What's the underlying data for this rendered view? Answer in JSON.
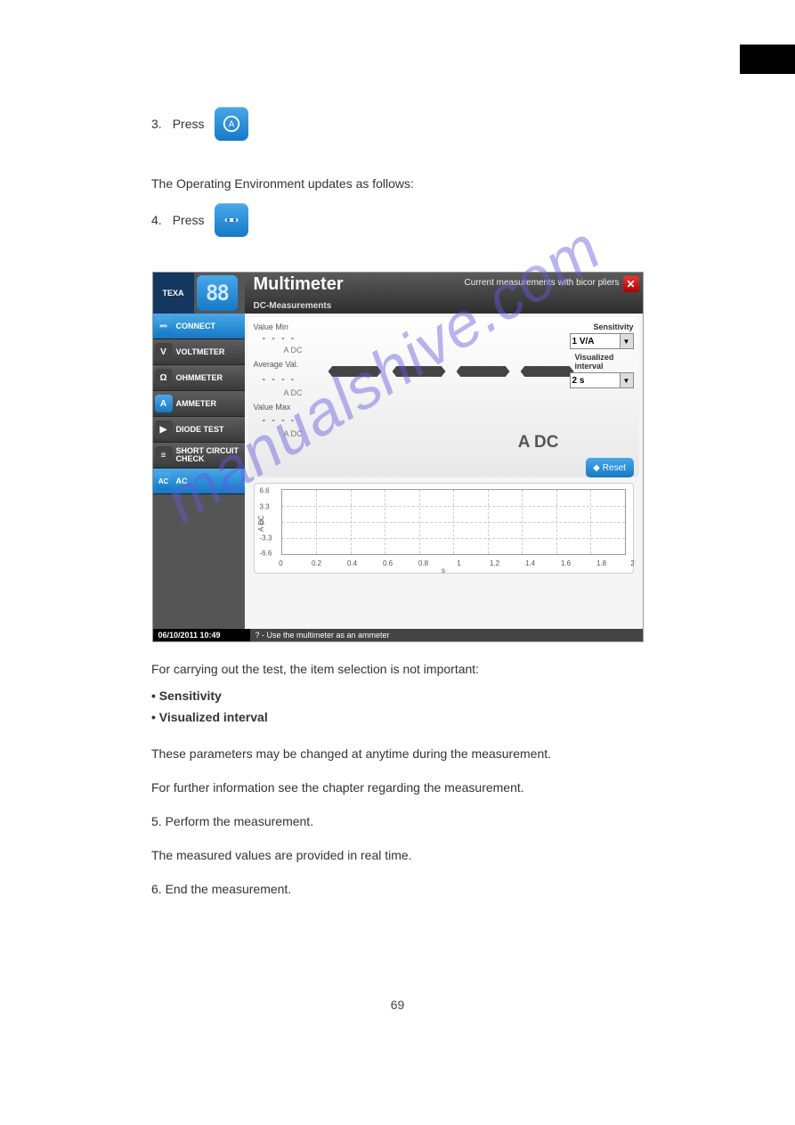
{
  "page": {
    "lang": "en",
    "number": "69",
    "watermark": "manualshive.com"
  },
  "instructions": {
    "step1_num": "3.",
    "step1_txt": "Press",
    "step1_after": "",
    "step2": "The Operating Environment updates as follows:",
    "step3_num": "4.",
    "step3_txt": "Press",
    "step3_after": ""
  },
  "app": {
    "logo": "TEXA",
    "display": "88",
    "title": "Multimeter",
    "subtitle": "DC-Measurements",
    "header_right": "Current measurements with bicor pliers",
    "sidebar": [
      {
        "label": "CONNECT",
        "sel": true,
        "ico": "⎓"
      },
      {
        "label": "VOLTMETER",
        "sel": false,
        "ico": "V"
      },
      {
        "label": "OHMMETER",
        "sel": false,
        "ico": "Ω"
      },
      {
        "label": "AMMETER",
        "sel": false,
        "ico": "A"
      },
      {
        "label": "DIODE TEST",
        "sel": false,
        "ico": "▶"
      },
      {
        "label": "SHORT CIRCUIT CHECK",
        "sel": false,
        "ico": "≡"
      },
      {
        "label": "AC",
        "sel": true,
        "ico": "AC"
      }
    ],
    "readings": {
      "min_lbl": "Value Min",
      "min_val": "- - - -",
      "min_unit": "A DC",
      "avg_lbl": "Average Val.",
      "avg_val": "- - - -",
      "avg_unit": "A DC",
      "max_lbl": "Value Max",
      "max_val": "- - - -",
      "max_unit": "A DC",
      "main_unit": "A DC"
    },
    "controls": {
      "sens_lbl": "Sensitivity",
      "sens_val": "1 V/A",
      "int_lbl": "Visualized interval",
      "int_val": "2 s",
      "reset": "Reset"
    },
    "status": {
      "timestamp": "06/10/2011  10:49",
      "hint": "? - Use the multimeter as an ammeter"
    }
  },
  "chart_data": {
    "type": "line",
    "title": "",
    "xlabel": "s",
    "ylabel": "A DC",
    "xlim": [
      0.0,
      2.0
    ],
    "ylim": [
      -6.6,
      6.6
    ],
    "x_ticks": [
      0.0,
      0.2,
      0.4,
      0.6,
      0.8,
      1.0,
      1.2,
      1.4,
      1.6,
      1.8,
      2.0
    ],
    "y_ticks": [
      -6.6,
      -3.3,
      0.0,
      3.3,
      6.6
    ],
    "series": [
      {
        "name": "A DC",
        "values": []
      }
    ]
  },
  "bodytext": {
    "intro": "For carrying out the test, the item selection is not important:",
    "bullets": [
      {
        "b": "Sensitivity",
        "rest": ""
      },
      {
        "b": "Visualized interval",
        "rest": ""
      }
    ],
    "note1": "These parameters may be changed at anytime during the measurement.",
    "more": "For further information see the chapter regarding the measurement.",
    "step5_num": "5.",
    "step5": "Perform the measurement.",
    "note2": "The measured values are provided in real time.",
    "step6_num": "6.",
    "step6": "End the measurement."
  }
}
